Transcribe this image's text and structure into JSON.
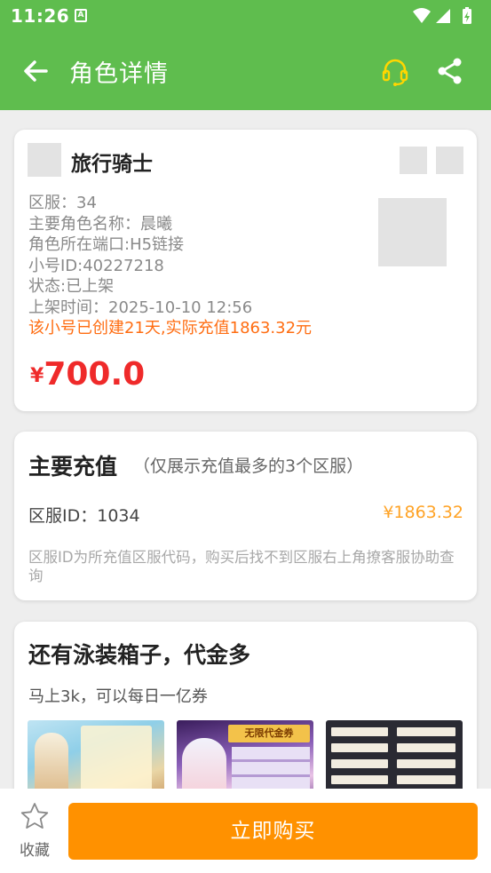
{
  "status_bar": {
    "time": "11:26",
    "notification_icon": "A"
  },
  "app_bar": {
    "title": "角色详情",
    "icons": [
      "back-arrow-icon",
      "headset-icon",
      "share-icon"
    ]
  },
  "listing": {
    "game_name": "旅行骑士",
    "details": [
      "区服：34",
      "主要角色名称：晨曦",
      "角色所在端口:H5链接",
      "小号ID:40227218",
      "状态:已上架",
      "上架时间：2025-10-10 12:56"
    ],
    "highlight": "该小号已创建21天,实际充值1863.32元",
    "price_currency": "¥",
    "price_amount": "700.0"
  },
  "recharge": {
    "title": "主要充值",
    "subtitle": "（仅展示充值最多的3个区服）",
    "server_label": "区服ID：1034",
    "server_amount": "¥1863.32",
    "note": "区服ID为所充值区服代码，购买后找不到区服右上角撩客服协助查询"
  },
  "description": {
    "title": "还有泳装箱子，代金多",
    "text": "马上3k，可以每日一亿券",
    "screenshot2_banner": "无限代金券"
  },
  "bottom_bar": {
    "favorite_label": "收藏",
    "buy_label": "立即购买"
  },
  "colors": {
    "primary_green": "#5fbd4e",
    "price_red": "#ef2a2a",
    "highlight_orange": "#ff6d12",
    "amount_yellow": "#ffa326",
    "buy_orange": "#ff9100",
    "headset_yellow": "#ffd600"
  }
}
